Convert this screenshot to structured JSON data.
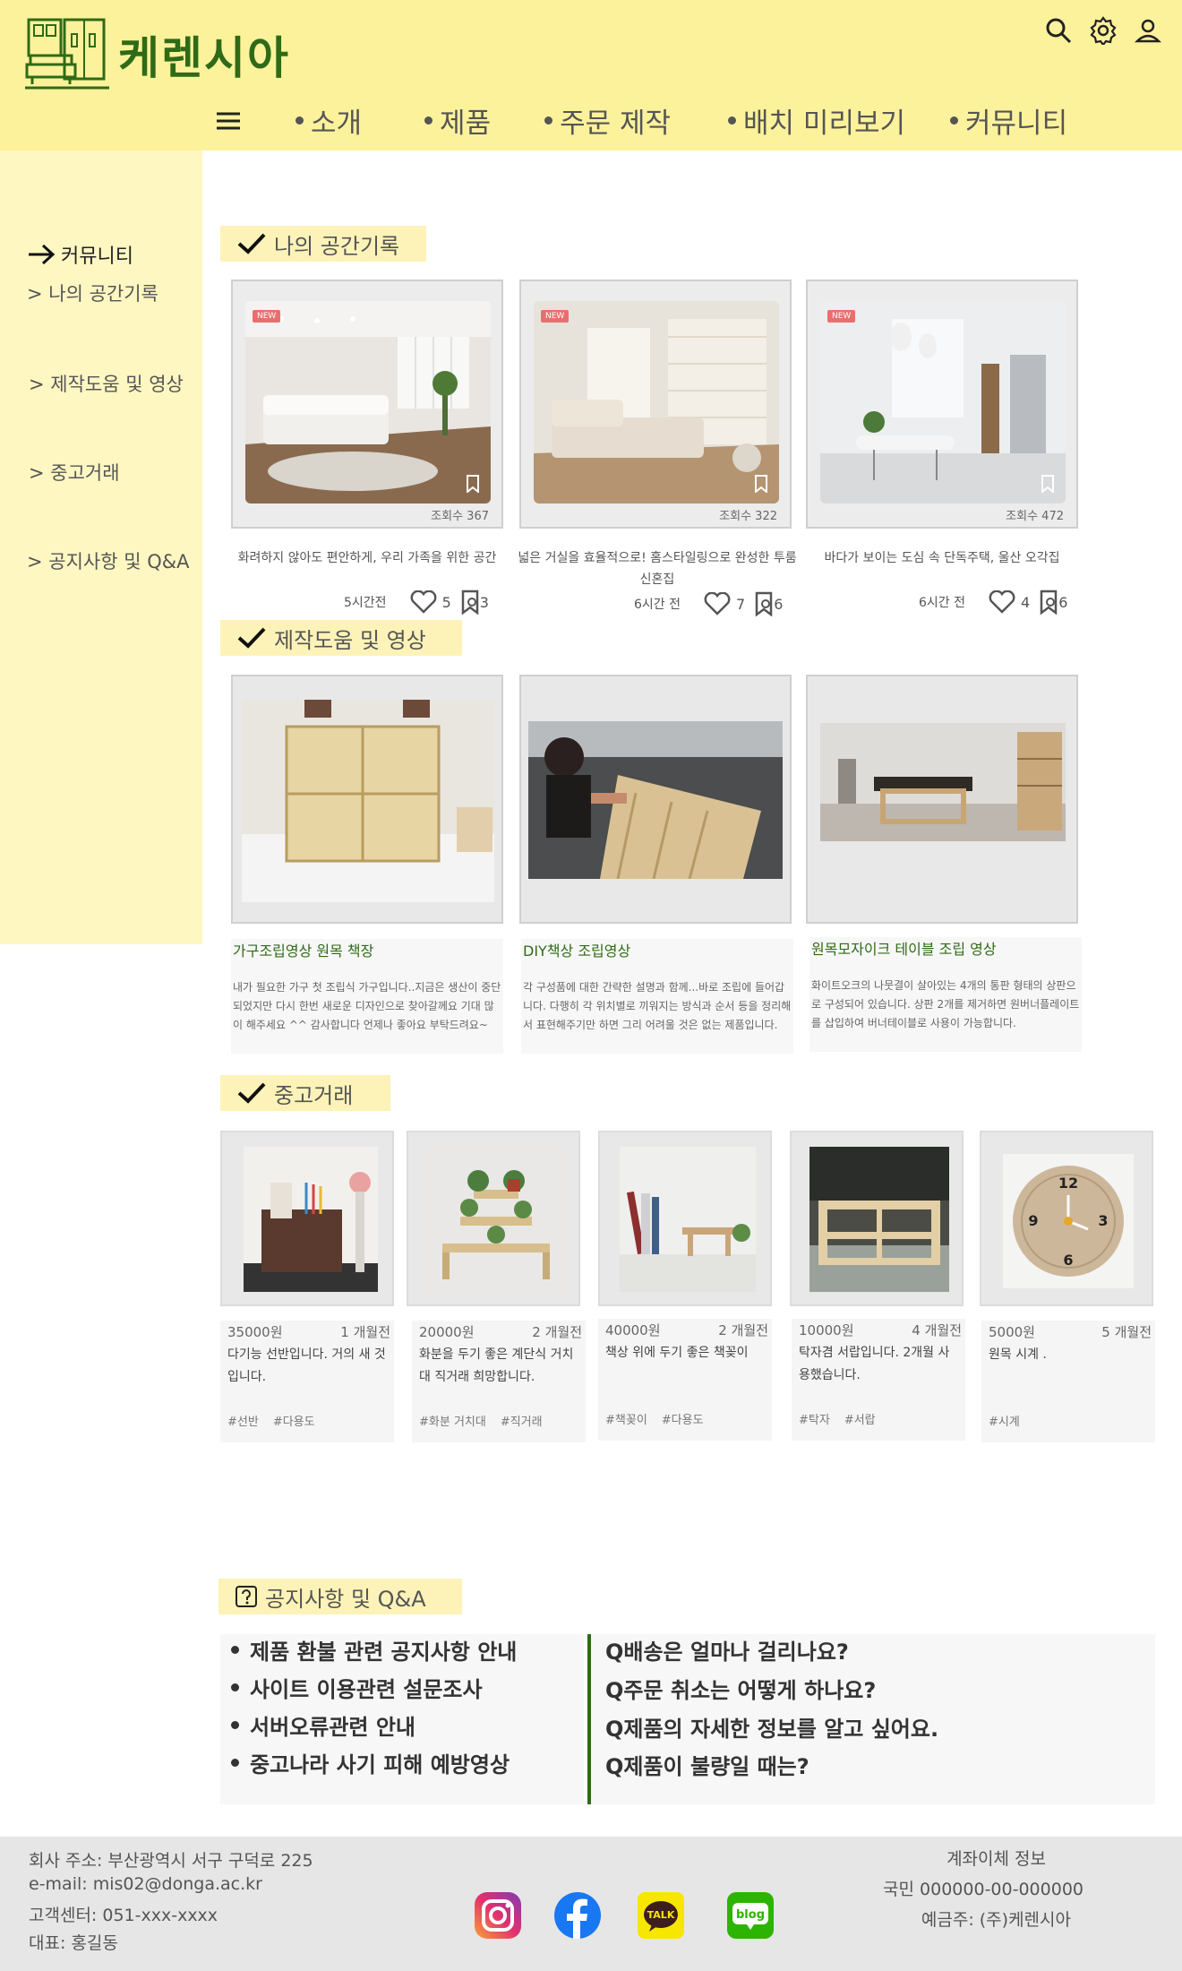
{
  "brand": {
    "name": "케렌시아",
    "color": "#2f6b16"
  },
  "colors": {
    "header_bg": "#fdf29c",
    "sidebar_bg": "#fff7c2",
    "section_bg": "#fdf3b8",
    "accent": "#2f6b16",
    "footer_bg": "#e6e6e6"
  },
  "header": {
    "icons": [
      "search-icon",
      "gear-icon",
      "user-icon"
    ],
    "nav": [
      "소개",
      "제품",
      "주문 제작",
      "배치 미리보기",
      "커뮤니티"
    ]
  },
  "sidebar": {
    "active": "커뮤니티",
    "items": [
      "> 나의 공간기록",
      "> 제작도움 및 영상",
      "> 중고거래",
      "> 공지사항 및 Q&A"
    ]
  },
  "sections": {
    "space": "나의 공간기록",
    "video": "제작도움 및 영상",
    "used": "중고거래",
    "notice": "공지사항 및 Q&A"
  },
  "space_posts": [
    {
      "badge": "NEW",
      "views": "조회수 367",
      "caption": "화려하지 않아도 편안하게, 우리 가족을 위한 공간",
      "time": "5시간전",
      "likes": "5",
      "bookmarks": "3"
    },
    {
      "badge": "NEW",
      "views": "조회수 322",
      "caption": "넓은 거실을 효율적으로! 홈스타일링으로 완성한 투룸 신혼집",
      "time": "6시간 전",
      "likes": "7",
      "bookmarks": "6"
    },
    {
      "badge": "NEW",
      "views": "조회수 472",
      "caption": "바다가 보이는 도심 속 단독주택, 울산 오각집",
      "time": "6시간 전",
      "likes": "4",
      "bookmarks": "6"
    }
  ],
  "videos": [
    {
      "title": "가구조립영상 원목 책장",
      "desc": "내가 필요한 가구 첫 조립식 가구입니다..지금은 생산이 중단되었지만 다시 한번 새로운 디자인으로 찾아갈께요 기대 많이 해주세요 ^^ 감사합니다 언제나 좋아요 부탁드려요~"
    },
    {
      "title": "DIY책상 조립영상",
      "desc": "각 구성품에 대한 간략한 설명과 함께...바로 조립에 들어갑니다. 다행히 각 위치별로 끼워지는 방식과 순서 등을 정리해서 표현해주기만 하면 그리 어려울 것은 없는 제품입니다."
    },
    {
      "title": "원목모자이크 테이블 조립 영상",
      "desc": "화이트오크의 나뭇결이 살아있는 4개의 통판 형태의 상판으로 구성되어 있습니다. 상판 2개를 제거하면 원버너플레이트를 삽입하여 버너테이블로 사용이 가능합니다."
    }
  ],
  "used_items": [
    {
      "price": "35000원",
      "date": "1 개월전",
      "desc": "다기능 선반입니다. 거의 새 것 입니다.",
      "tags": [
        "#선반",
        "#다용도"
      ]
    },
    {
      "price": "20000원",
      "date": "2 개월전",
      "desc": "화분을 두기 좋은 계단식 거치대 직거래 희망합니다.",
      "tags": [
        "#화분 거치대",
        "#직거래"
      ]
    },
    {
      "price": "40000원",
      "date": "2 개월전",
      "desc": "책상 위에 두기 좋은 책꽂이",
      "tags": [
        "#책꽂이",
        "#다용도"
      ]
    },
    {
      "price": "10000원",
      "date": "4 개월전",
      "desc": "탁자겸 서랍입니다. 2개월 사용했습니다.",
      "tags": [
        "#탁자",
        "#서랍"
      ]
    },
    {
      "price": "5000원",
      "date": "5 개월전",
      "desc": "원목 시계 .",
      "tags": [
        "#시계"
      ]
    }
  ],
  "notices": [
    "제품 환불 관련 공지사항 안내",
    "사이트 이용관련 설문조사",
    "서버오류관련 안내",
    "중고나라 사기 피해 예방영상"
  ],
  "qa": [
    "Q배송은 얼마나 걸리나요?",
    "Q주문 취소는 어떻게 하나요?",
    "Q제품의 자세한 정보를 알고 싶어요.",
    "Q제품이 불량일 때는?"
  ],
  "footer": {
    "address": "회사 주소: 부산광역시 서구 구덕로 225",
    "email": "e-mail: mis02@donga.ac.kr",
    "phone": "고객센터: 051-xxx-xxxx",
    "ceo": "대표: 홍길동",
    "bank_title": "계좌이체 정보",
    "bank_account": "국민 000000-00-000000",
    "bank_holder": "예금주: (주)케렌시아",
    "social": [
      "instagram-icon",
      "facebook-icon",
      "kakaotalk-icon",
      "naver-blog-icon"
    ],
    "talk_label": "TALK",
    "blog_label": "blog"
  }
}
